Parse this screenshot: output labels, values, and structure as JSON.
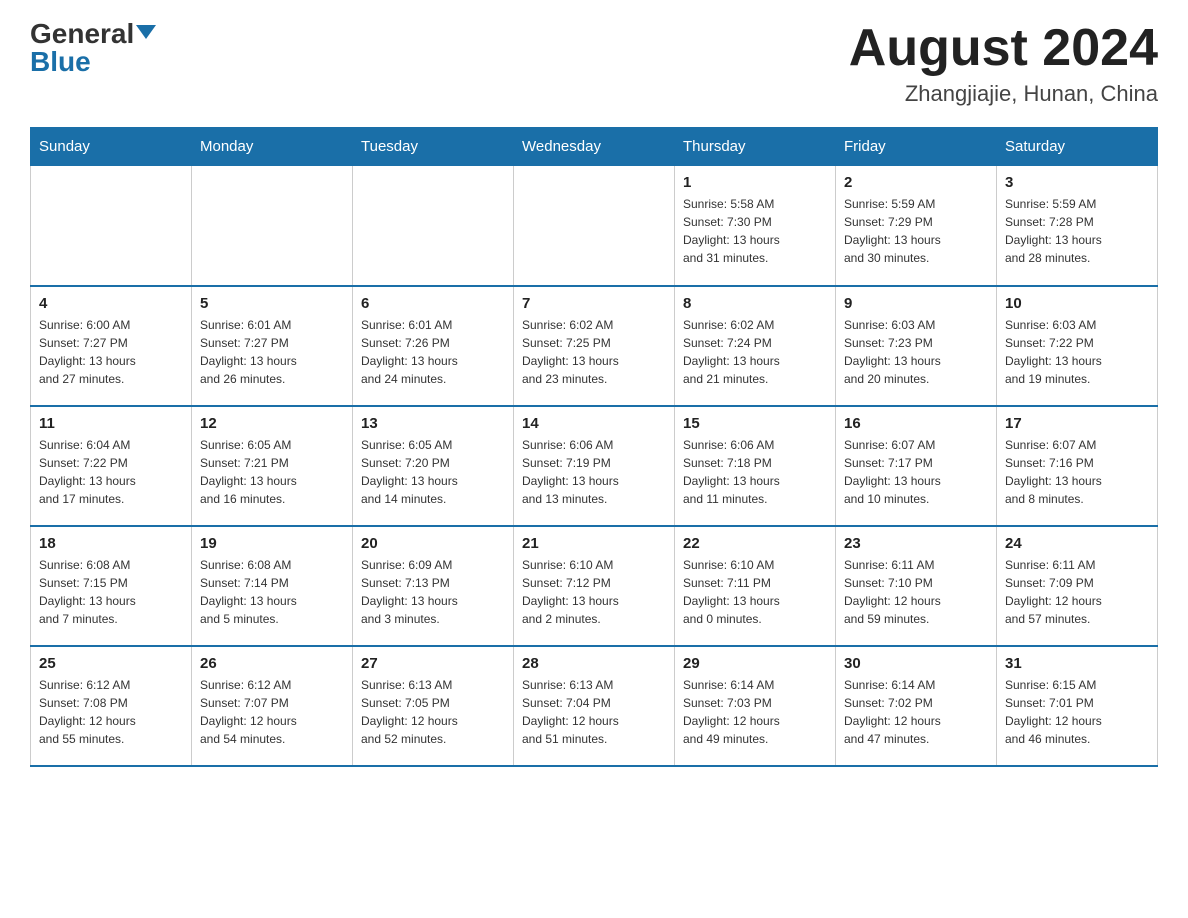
{
  "header": {
    "logo_general": "General",
    "logo_blue": "Blue",
    "month_title": "August 2024",
    "location": "Zhangjiajie, Hunan, China"
  },
  "days_of_week": [
    "Sunday",
    "Monday",
    "Tuesday",
    "Wednesday",
    "Thursday",
    "Friday",
    "Saturday"
  ],
  "weeks": [
    [
      {
        "day": "",
        "info": ""
      },
      {
        "day": "",
        "info": ""
      },
      {
        "day": "",
        "info": ""
      },
      {
        "day": "",
        "info": ""
      },
      {
        "day": "1",
        "info": "Sunrise: 5:58 AM\nSunset: 7:30 PM\nDaylight: 13 hours\nand 31 minutes."
      },
      {
        "day": "2",
        "info": "Sunrise: 5:59 AM\nSunset: 7:29 PM\nDaylight: 13 hours\nand 30 minutes."
      },
      {
        "day": "3",
        "info": "Sunrise: 5:59 AM\nSunset: 7:28 PM\nDaylight: 13 hours\nand 28 minutes."
      }
    ],
    [
      {
        "day": "4",
        "info": "Sunrise: 6:00 AM\nSunset: 7:27 PM\nDaylight: 13 hours\nand 27 minutes."
      },
      {
        "day": "5",
        "info": "Sunrise: 6:01 AM\nSunset: 7:27 PM\nDaylight: 13 hours\nand 26 minutes."
      },
      {
        "day": "6",
        "info": "Sunrise: 6:01 AM\nSunset: 7:26 PM\nDaylight: 13 hours\nand 24 minutes."
      },
      {
        "day": "7",
        "info": "Sunrise: 6:02 AM\nSunset: 7:25 PM\nDaylight: 13 hours\nand 23 minutes."
      },
      {
        "day": "8",
        "info": "Sunrise: 6:02 AM\nSunset: 7:24 PM\nDaylight: 13 hours\nand 21 minutes."
      },
      {
        "day": "9",
        "info": "Sunrise: 6:03 AM\nSunset: 7:23 PM\nDaylight: 13 hours\nand 20 minutes."
      },
      {
        "day": "10",
        "info": "Sunrise: 6:03 AM\nSunset: 7:22 PM\nDaylight: 13 hours\nand 19 minutes."
      }
    ],
    [
      {
        "day": "11",
        "info": "Sunrise: 6:04 AM\nSunset: 7:22 PM\nDaylight: 13 hours\nand 17 minutes."
      },
      {
        "day": "12",
        "info": "Sunrise: 6:05 AM\nSunset: 7:21 PM\nDaylight: 13 hours\nand 16 minutes."
      },
      {
        "day": "13",
        "info": "Sunrise: 6:05 AM\nSunset: 7:20 PM\nDaylight: 13 hours\nand 14 minutes."
      },
      {
        "day": "14",
        "info": "Sunrise: 6:06 AM\nSunset: 7:19 PM\nDaylight: 13 hours\nand 13 minutes."
      },
      {
        "day": "15",
        "info": "Sunrise: 6:06 AM\nSunset: 7:18 PM\nDaylight: 13 hours\nand 11 minutes."
      },
      {
        "day": "16",
        "info": "Sunrise: 6:07 AM\nSunset: 7:17 PM\nDaylight: 13 hours\nand 10 minutes."
      },
      {
        "day": "17",
        "info": "Sunrise: 6:07 AM\nSunset: 7:16 PM\nDaylight: 13 hours\nand 8 minutes."
      }
    ],
    [
      {
        "day": "18",
        "info": "Sunrise: 6:08 AM\nSunset: 7:15 PM\nDaylight: 13 hours\nand 7 minutes."
      },
      {
        "day": "19",
        "info": "Sunrise: 6:08 AM\nSunset: 7:14 PM\nDaylight: 13 hours\nand 5 minutes."
      },
      {
        "day": "20",
        "info": "Sunrise: 6:09 AM\nSunset: 7:13 PM\nDaylight: 13 hours\nand 3 minutes."
      },
      {
        "day": "21",
        "info": "Sunrise: 6:10 AM\nSunset: 7:12 PM\nDaylight: 13 hours\nand 2 minutes."
      },
      {
        "day": "22",
        "info": "Sunrise: 6:10 AM\nSunset: 7:11 PM\nDaylight: 13 hours\nand 0 minutes."
      },
      {
        "day": "23",
        "info": "Sunrise: 6:11 AM\nSunset: 7:10 PM\nDaylight: 12 hours\nand 59 minutes."
      },
      {
        "day": "24",
        "info": "Sunrise: 6:11 AM\nSunset: 7:09 PM\nDaylight: 12 hours\nand 57 minutes."
      }
    ],
    [
      {
        "day": "25",
        "info": "Sunrise: 6:12 AM\nSunset: 7:08 PM\nDaylight: 12 hours\nand 55 minutes."
      },
      {
        "day": "26",
        "info": "Sunrise: 6:12 AM\nSunset: 7:07 PM\nDaylight: 12 hours\nand 54 minutes."
      },
      {
        "day": "27",
        "info": "Sunrise: 6:13 AM\nSunset: 7:05 PM\nDaylight: 12 hours\nand 52 minutes."
      },
      {
        "day": "28",
        "info": "Sunrise: 6:13 AM\nSunset: 7:04 PM\nDaylight: 12 hours\nand 51 minutes."
      },
      {
        "day": "29",
        "info": "Sunrise: 6:14 AM\nSunset: 7:03 PM\nDaylight: 12 hours\nand 49 minutes."
      },
      {
        "day": "30",
        "info": "Sunrise: 6:14 AM\nSunset: 7:02 PM\nDaylight: 12 hours\nand 47 minutes."
      },
      {
        "day": "31",
        "info": "Sunrise: 6:15 AM\nSunset: 7:01 PM\nDaylight: 12 hours\nand 46 minutes."
      }
    ]
  ]
}
